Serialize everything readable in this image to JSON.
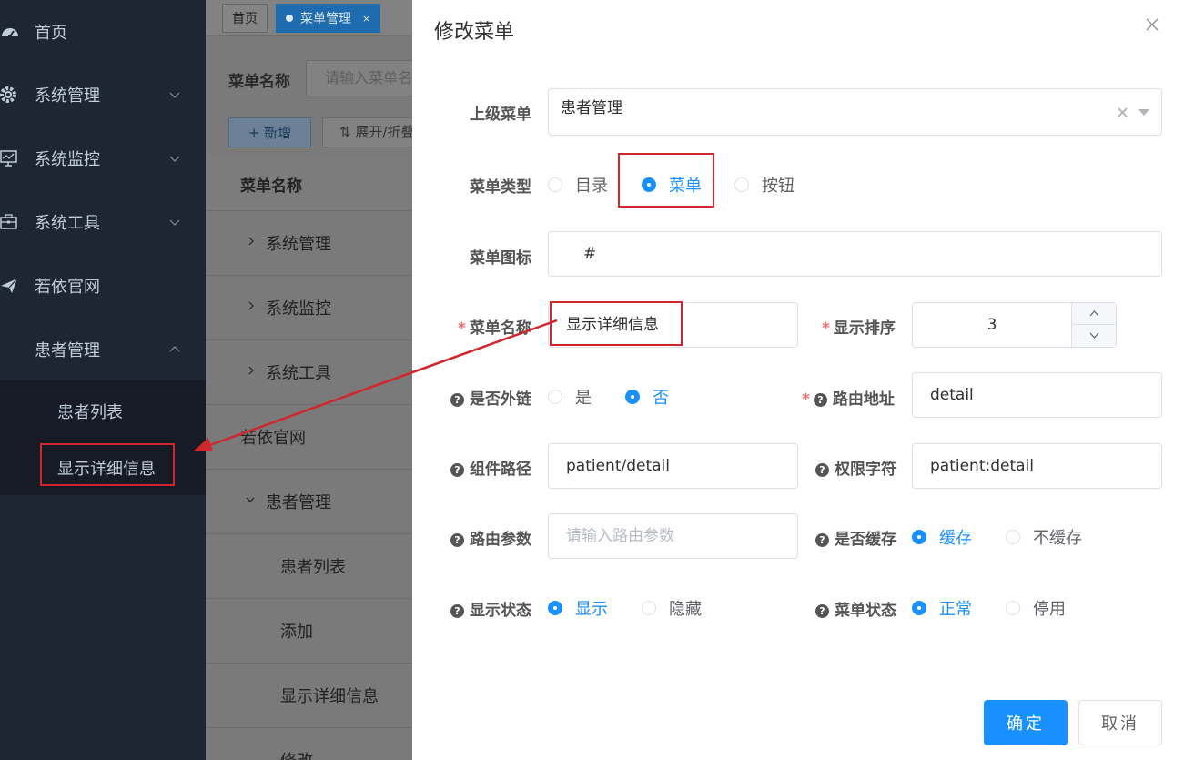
{
  "sidebar": {
    "items": [
      {
        "label": "首页",
        "icon": "dashboard-icon"
      },
      {
        "label": "系统管理",
        "icon": "gear-icon"
      },
      {
        "label": "系统监控",
        "icon": "monitor-icon"
      },
      {
        "label": "系统工具",
        "icon": "toolbox-icon"
      },
      {
        "label": "若依官网",
        "icon": "send-icon"
      },
      {
        "label": "患者管理",
        "icon": ""
      }
    ],
    "sub_items": [
      {
        "label": "患者列表"
      },
      {
        "label": "显示详细信息"
      }
    ]
  },
  "tabs": {
    "home": "首页",
    "active": "菜单管理",
    "close": "×"
  },
  "main": {
    "search_label": "菜单名称",
    "search_placeholder": "请输入菜单名称",
    "add_button": "+ 新增",
    "expand_button": "⇅ 展开/折叠",
    "table_header": "菜单名称",
    "rows": [
      {
        "label": "系统管理"
      },
      {
        "label": "系统监控"
      },
      {
        "label": "系统工具"
      },
      {
        "label": "若依官网"
      },
      {
        "label": "患者管理"
      },
      {
        "label": "患者列表"
      },
      {
        "label": "添加"
      },
      {
        "label": "显示详细信息"
      },
      {
        "label": "修改"
      }
    ]
  },
  "dialog": {
    "title": "修改菜单",
    "parent_menu": {
      "label": "上级菜单",
      "value": "患者管理"
    },
    "menu_type": {
      "label": "菜单类型",
      "options": [
        "目录",
        "菜单",
        "按钮"
      ],
      "selected": "菜单"
    },
    "menu_icon": {
      "label": "菜单图标",
      "value": "#"
    },
    "menu_name": {
      "label": "菜单名称",
      "value": "显示详细信息"
    },
    "sort_order": {
      "label": "显示排序",
      "value": "3"
    },
    "is_external": {
      "label": "是否外链",
      "options": [
        "是",
        "否"
      ],
      "selected": "否"
    },
    "route_path": {
      "label": "路由地址",
      "value": "detail"
    },
    "component_path": {
      "label": "组件路径",
      "value": "patient/detail"
    },
    "permission": {
      "label": "权限字符",
      "value": "patient:detail"
    },
    "route_params": {
      "label": "路由参数",
      "placeholder": "请输入路由参数"
    },
    "is_cache": {
      "label": "是否缓存",
      "options": [
        "缓存",
        "不缓存"
      ],
      "selected": "缓存"
    },
    "visible": {
      "label": "显示状态",
      "options": [
        "显示",
        "隐藏"
      ],
      "selected": "显示"
    },
    "status": {
      "label": "菜单状态",
      "options": [
        "正常",
        "停用"
      ],
      "selected": "正常"
    },
    "required_mark": "*",
    "help_mark": "?",
    "confirm_button": "确定",
    "cancel_button": "取消"
  },
  "colors": {
    "primary": "#1890ff",
    "sidebar_bg": "#1f2633",
    "annotation_red": "#d0262d"
  }
}
